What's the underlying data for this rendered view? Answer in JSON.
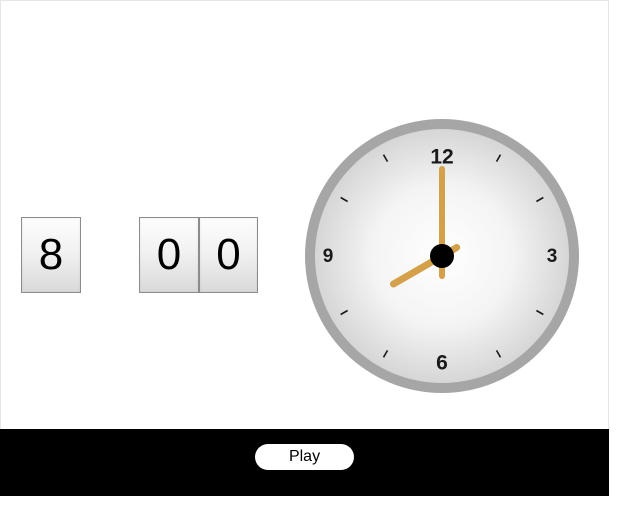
{
  "digital_time": {
    "hour": "8",
    "minute_tens": "0",
    "minute_ones": "0"
  },
  "clock": {
    "numerals": {
      "twelve": "12",
      "three": "3",
      "six": "6",
      "nine": "9"
    },
    "time": {
      "hours": 8,
      "minutes": 0
    },
    "colors": {
      "rim": "#a6a6a6",
      "face_center": "#ffffff",
      "face_edge": "#d6d6d6",
      "hands": "#d4a04a",
      "hub": "#000000"
    }
  },
  "controls": {
    "play_label": "Play"
  }
}
